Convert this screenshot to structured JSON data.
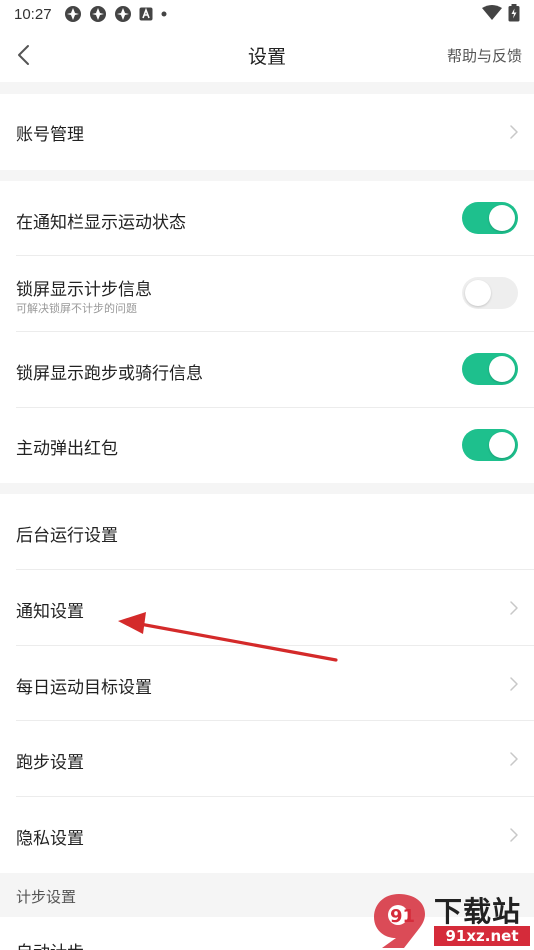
{
  "status_bar": {
    "time": "10:27",
    "notification_icons": [
      "app-icon",
      "app-icon",
      "app-icon",
      "a-icon",
      "dot-icon"
    ],
    "right_icons": [
      "wifi-icon",
      "battery-icon"
    ]
  },
  "app_bar": {
    "back_icon": "chevron-left-icon",
    "title": "设置",
    "help_label": "帮助与反馈"
  },
  "account_section": {
    "label": "账号管理"
  },
  "toggle_section": {
    "items": [
      {
        "label": "在通知栏显示运动状态",
        "sub": "",
        "state": "on"
      },
      {
        "label": "锁屏显示计步信息",
        "sub": "可解决锁屏不计步的问题",
        "state": "off"
      },
      {
        "label": "锁屏显示跑步或骑行信息",
        "sub": "",
        "state": "on"
      },
      {
        "label": "主动弹出红包",
        "sub": "",
        "state": "on"
      }
    ]
  },
  "nav_section": {
    "items": [
      {
        "label": "后台运行设置",
        "chevron": false
      },
      {
        "label": "通知设置",
        "chevron": true
      },
      {
        "label": "每日运动目标设置",
        "chevron": true
      },
      {
        "label": "跑步设置",
        "chevron": true
      },
      {
        "label": "隐私设置",
        "chevron": true
      }
    ]
  },
  "step_section": {
    "header": "计步设置",
    "partial_item": "自动计步"
  },
  "annotation": {
    "arrow_color": "#d42a2a"
  },
  "watermark": {
    "logo_text": "91",
    "text": "下载站",
    "domain": "91xz.net",
    "color": "#d52b3a"
  },
  "colors": {
    "toggle_on": "#1ec08d",
    "toggle_off": "#eeeeee",
    "section_bg": "#f5f5f5"
  }
}
